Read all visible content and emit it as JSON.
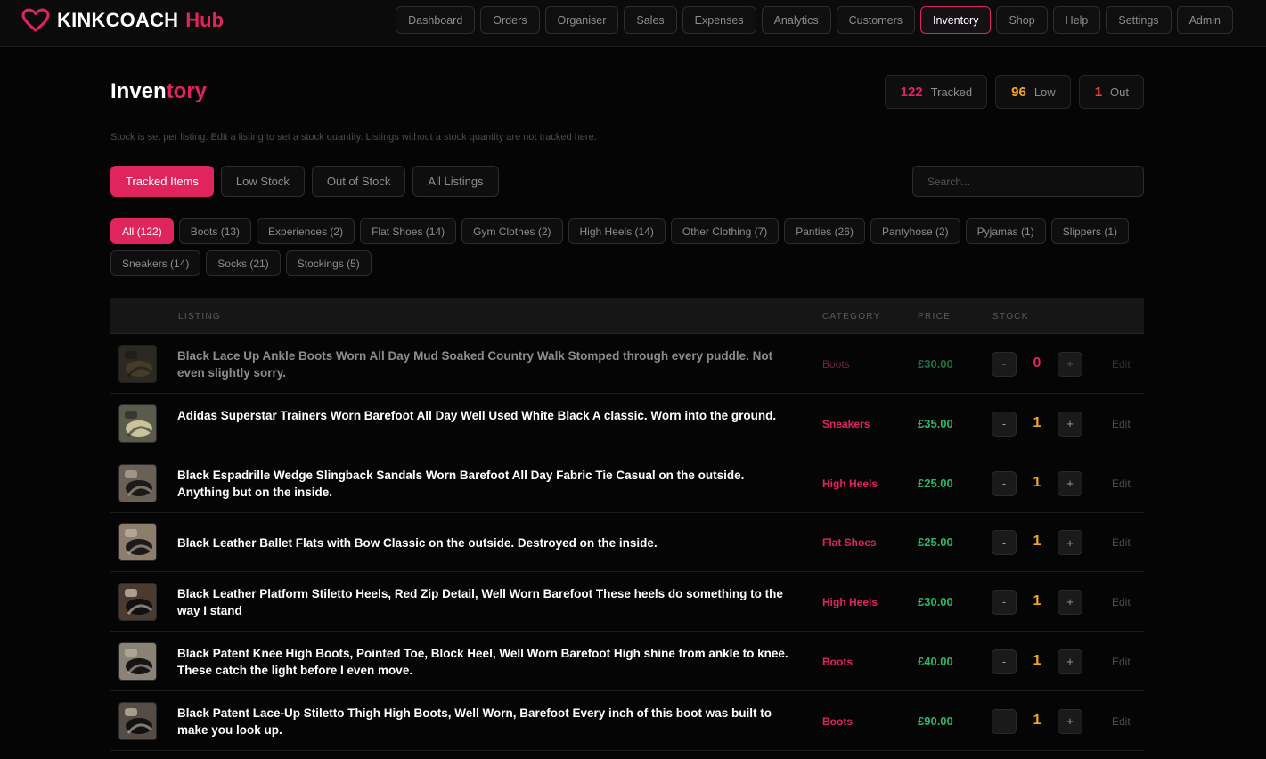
{
  "app": {
    "brand": "KINKCOACH",
    "brand_accent": "Hub",
    "accent_color": "#e0245e"
  },
  "nav": [
    {
      "label": "Dashboard"
    },
    {
      "label": "Orders"
    },
    {
      "label": "Organiser"
    },
    {
      "label": "Sales"
    },
    {
      "label": "Expenses"
    },
    {
      "label": "Analytics"
    },
    {
      "label": "Customers"
    },
    {
      "label": "Inventory",
      "active": true
    },
    {
      "label": "Shop"
    },
    {
      "label": "Help"
    },
    {
      "label": "Settings"
    },
    {
      "label": "Admin"
    }
  ],
  "page": {
    "title_main": "Inven",
    "title_accent": "tory",
    "subtitle": "Stock is set per listing. Edit a listing to set a stock quantity. Listings without a stock quantity are not tracked here."
  },
  "stats": [
    {
      "value": "122",
      "label": "Tracked",
      "color": "#e0245e"
    },
    {
      "value": "96",
      "label": "Low",
      "color": "#f5a623"
    },
    {
      "value": "1",
      "label": "Out",
      "color": "#ff3b3b"
    }
  ],
  "filters": [
    {
      "label": "Tracked Items",
      "active": true
    },
    {
      "label": "Low Stock"
    },
    {
      "label": "Out of Stock"
    },
    {
      "label": "All Listings"
    }
  ],
  "search": {
    "placeholder": "Search..."
  },
  "categories": [
    {
      "label": "All (122)",
      "active": true
    },
    {
      "label": "Boots (13)"
    },
    {
      "label": "Experiences (2)"
    },
    {
      "label": "Flat Shoes (14)"
    },
    {
      "label": "Gym Clothes (2)"
    },
    {
      "label": "High Heels (14)"
    },
    {
      "label": "Other Clothing (7)"
    },
    {
      "label": "Panties (26)"
    },
    {
      "label": "Pantyhose (2)"
    },
    {
      "label": "Pyjamas (1)"
    },
    {
      "label": "Slippers (1)"
    },
    {
      "label": "Sneakers (14)"
    },
    {
      "label": "Socks (21)"
    },
    {
      "label": "Stockings (5)"
    }
  ],
  "table": {
    "headers": {
      "listing": "LISTING",
      "category": "CATEGORY",
      "price": "PRICE",
      "stock": "STOCK"
    },
    "minus_label": "-",
    "plus_label": "+",
    "edit_label": "Edit",
    "rows": [
      {
        "title": "Black Lace Up Ankle Boots Worn All Day Mud Soaked Country Walk Stomped through every puddle. Not even slightly sorry.",
        "category": "Boots",
        "price": "£30.00",
        "stock": "0",
        "out_of_stock": true
      },
      {
        "title": "Adidas Superstar Trainers Worn Barefoot All Day Well Used White Black A classic. Worn into the ground.",
        "category": "Sneakers",
        "price": "£35.00",
        "stock": "1"
      },
      {
        "title": "Black Espadrille Wedge Slingback Sandals Worn Barefoot All Day Fabric Tie Casual on the outside. Anything but on the inside.",
        "category": "High Heels",
        "price": "£25.00",
        "stock": "1"
      },
      {
        "title": "Black Leather Ballet Flats with Bow Classic on the outside. Destroyed on the inside.",
        "category": "Flat Shoes",
        "price": "£25.00",
        "stock": "1"
      },
      {
        "title": "Black Leather Platform Stiletto Heels, Red Zip Detail, Well Worn Barefoot These heels do something to the way I stand",
        "category": "High Heels",
        "price": "£30.00",
        "stock": "1"
      },
      {
        "title": "Black Patent Knee High Boots, Pointed Toe, Block Heel, Well Worn Barefoot High shine from ankle to knee. These catch the light before I even move.",
        "category": "Boots",
        "price": "£40.00",
        "stock": "1"
      },
      {
        "title": "Black Patent Lace-Up Stiletto Thigh High Boots, Well Worn, Barefoot Every inch of this boot was built to make you look up.",
        "category": "Boots",
        "price": "£90.00",
        "stock": "1"
      }
    ]
  },
  "colors": {
    "stock_out": "#e0245e",
    "stock_low": "#f5a623",
    "price": "#2bb567"
  }
}
